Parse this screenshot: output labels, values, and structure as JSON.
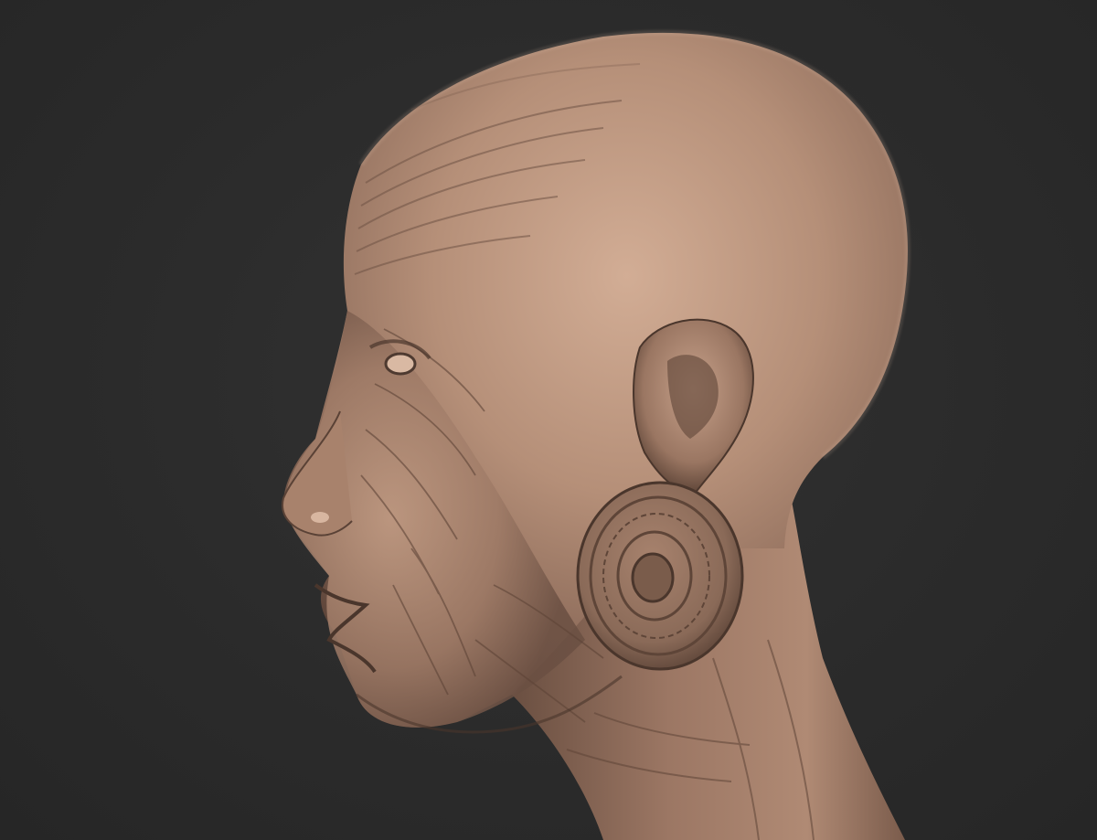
{
  "scene": {
    "subject": "sculpted-head-profile",
    "colors": {
      "background": "#2b2b2b",
      "clay_light": "#c9a28a",
      "clay_mid": "#a8826c",
      "clay_dark": "#6e5244",
      "clay_shadow": "#3e2e27"
    },
    "icons": [
      "earring-disc-icon"
    ]
  }
}
